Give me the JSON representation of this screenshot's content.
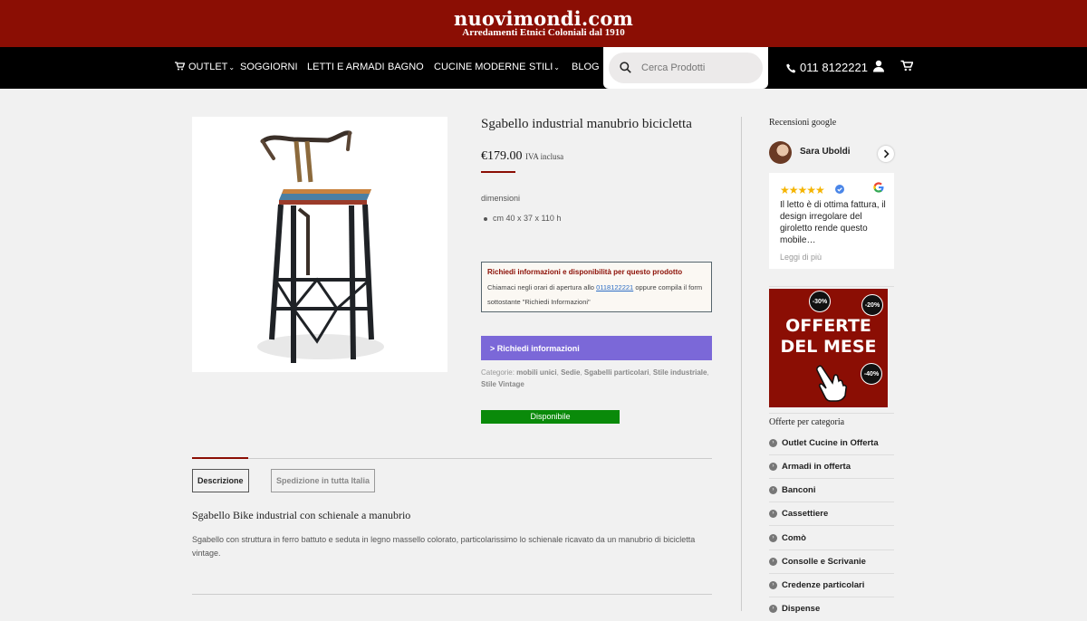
{
  "header": {
    "logo": "nuovimondi.com",
    "tagline": "Arredamenti Etnici Coloniali dal 1910",
    "brand_color": "#8b0e04"
  },
  "nav": {
    "items": [
      {
        "label": "OUTLET",
        "dropdown": true,
        "icon": "cart-icon"
      },
      {
        "label": "SOGGIORNI",
        "dropdown": false
      },
      {
        "label": "LETTI E ARMADI",
        "dropdown": false
      },
      {
        "label": "BAGNO",
        "dropdown": false
      },
      {
        "label": "CUCINE MODERNE",
        "dropdown": false
      },
      {
        "label": "STILI",
        "dropdown": true
      },
      {
        "label": "BLOG",
        "dropdown": false
      }
    ],
    "search_placeholder": "Cerca Prodotti",
    "phone": "011 8122221",
    "icons": [
      "phone-icon",
      "user-icon",
      "cart-icon"
    ]
  },
  "product": {
    "title": "Sgabello industrial manubrio bicicletta",
    "price": "€179.00",
    "price_note": "IVA inclusa",
    "dimensions_label": "dimensioni",
    "dimensions": "cm 40 x 37 x 110 h",
    "info_box": {
      "heading": "Richiedi informazioni e disponibilità per questo prodotto",
      "text_before": "Chiamaci negli orari di apertura allo",
      "phone_link": "0118122221",
      "text_after": "oppure compila il form sottostante \"Richiedi Informazioni\""
    },
    "request_button": "> Richiedi informazioni",
    "request_button_color": "#7b68d8",
    "categories_label": "Categorie:",
    "categories": [
      "mobili unici",
      "Sedie",
      "Sgabelli particolari",
      "Stile industriale",
      "Stile Vintage"
    ],
    "availability": "Disponibile",
    "availability_color": "#0a8a0a"
  },
  "tabs": [
    {
      "label": "Descrizione",
      "active": true
    },
    {
      "label": "Spedizione in tutta Italia",
      "active": false
    }
  ],
  "description": {
    "title": "Sgabello Bike industrial con schienale a manubrio",
    "text": "Sgabello con struttura in ferro battuto e seduta in legno massello colorato, particolarissimo lo schienale ricavato da un manubrio di bicicletta vintage."
  },
  "sidebar": {
    "reviews_heading": "Recensioni google",
    "reviewer": "Sara Uboldi",
    "rating": 5,
    "review_text": "Il letto è di ottima fattura, il design irregolare del giroletto rende questo mobile…",
    "read_more": "Leggi di più",
    "promo": {
      "line1": "OFFERTE",
      "line2": "DEL MESE",
      "badges": [
        "-30%",
        "-20%",
        "-40%"
      ]
    },
    "offers_heading": "Offerte per categoria",
    "categories": [
      "Outlet Cucine in Offerta",
      "Armadi in offerta",
      "Banconi",
      "Cassettiere",
      "Comò",
      "Consolle e Scrivanie",
      "Credenze particolari",
      "Dispense"
    ]
  }
}
